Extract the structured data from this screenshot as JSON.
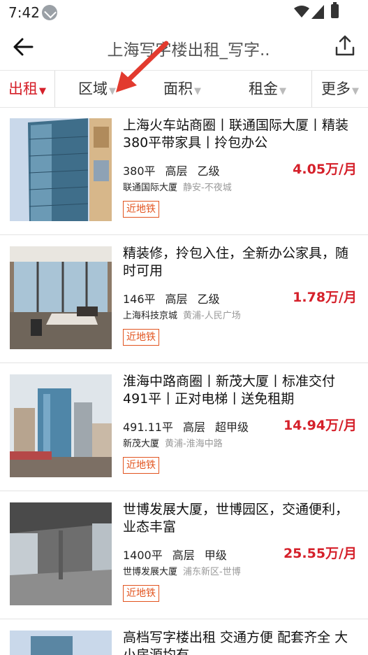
{
  "status": {
    "time": "7:42"
  },
  "header": {
    "title": "上海写字楼出租_写字.."
  },
  "filters": [
    {
      "label": "出租",
      "active": true
    },
    {
      "label": "区域",
      "active": false
    },
    {
      "label": "面积",
      "active": false
    },
    {
      "label": "租金",
      "active": false
    },
    {
      "label": "更多",
      "active": false
    }
  ],
  "listings": [
    {
      "title": "上海火车站商圈丨联通国际大厦丨精装380平带家具丨拎包办公",
      "area": "380平",
      "floor": "高层",
      "grade": "乙级",
      "price": "4.05万/月",
      "building": "联通国际大厦",
      "district": "静安-不夜城",
      "tag": "近地铁"
    },
    {
      "title": "精装修，拎包入住，全新办公家具，随时可用",
      "area": "146平",
      "floor": "高层",
      "grade": "乙级",
      "price": "1.78万/月",
      "building": "上海科技京城",
      "district": "黄浦-人民广场",
      "tag": "近地铁"
    },
    {
      "title": "淮海中路商圈丨新茂大厦丨标准交付491平丨正对电梯丨送免租期",
      "area": "491.11平",
      "floor": "高层",
      "grade": "超甲级",
      "price": "14.94万/月",
      "building": "新茂大厦",
      "district": "黄浦-淮海中路",
      "tag": "近地铁"
    },
    {
      "title": "世博发展大厦，世博园区，交通便利，业态丰富",
      "area": "1400平",
      "floor": "高层",
      "grade": "甲级",
      "price": "25.55万/月",
      "building": "世博发展大厦",
      "district": "浦东新区-世博",
      "tag": "近地铁"
    },
    {
      "title": "高档写字楼出租 交通方便 配套齐全 大小房源均有"
    }
  ]
}
